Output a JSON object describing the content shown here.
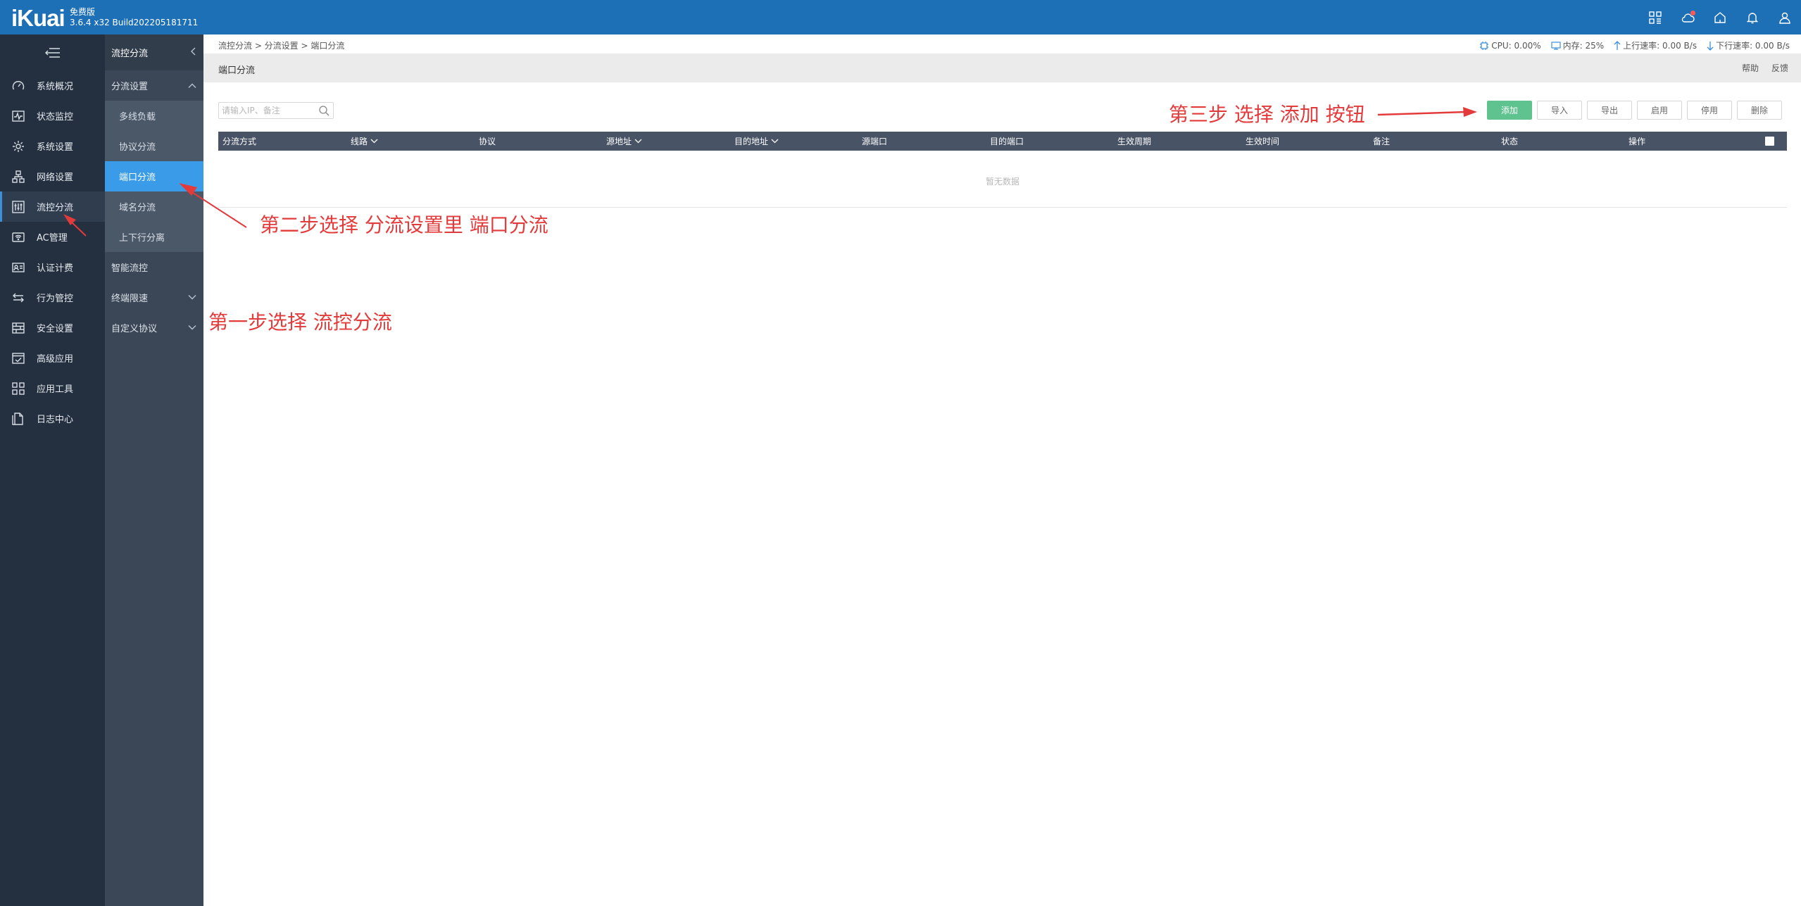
{
  "app": {
    "logo": "iKuai",
    "edition": "免费版",
    "build": "3.6.4 x32 Build202205181711"
  },
  "topbar_icons": [
    "apps-grid-icon",
    "cloud-icon",
    "home-icon",
    "bell-icon",
    "user-icon"
  ],
  "sidebar": {
    "items": [
      {
        "label": "系统概况",
        "icon": "dashboard-icon"
      },
      {
        "label": "状态监控",
        "icon": "monitor-icon"
      },
      {
        "label": "系统设置",
        "icon": "gear-icon"
      },
      {
        "label": "网络设置",
        "icon": "network-icon"
      },
      {
        "label": "流控分流",
        "icon": "sliders-icon",
        "active": true
      },
      {
        "label": "AC管理",
        "icon": "wifi-icon"
      },
      {
        "label": "认证计费",
        "icon": "id-card-icon"
      },
      {
        "label": "行为管控",
        "icon": "swap-icon"
      },
      {
        "label": "安全设置",
        "icon": "firewall-icon"
      },
      {
        "label": "高级应用",
        "icon": "check-window-icon"
      },
      {
        "label": "应用工具",
        "icon": "tools-grid-icon"
      },
      {
        "label": "日志中心",
        "icon": "document-icon"
      }
    ]
  },
  "subnav": {
    "title": "流控分流",
    "group_open": "分流设置",
    "sub_items": [
      "多线负载",
      "协议分流",
      "端口分流",
      "域名分流",
      "上下行分离"
    ],
    "active_sub": "端口分流",
    "groups_after": [
      {
        "label": "智能流控",
        "has_chevron": false
      },
      {
        "label": "终端限速",
        "has_chevron": true
      },
      {
        "label": "自定义协议",
        "has_chevron": true
      }
    ]
  },
  "breadcrumb": "流控分流 > 分流设置 > 端口分流",
  "stats": {
    "cpu": "CPU: 0.00%",
    "memory": "内存: 25%",
    "upload": "上行速率: 0.00 B/s",
    "download": "下行速率: 0.00 B/s"
  },
  "page": {
    "title": "端口分流",
    "help": "帮助",
    "feedback": "反馈"
  },
  "search": {
    "placeholder": "请输入IP、备注",
    "value": ""
  },
  "toolbar": {
    "add": "添加",
    "import": "导入",
    "export": "导出",
    "enable": "启用",
    "disable": "停用",
    "delete": "删除"
  },
  "table": {
    "columns": [
      {
        "label": "分流方式",
        "sortable": false
      },
      {
        "label": "线路",
        "sortable": true
      },
      {
        "label": "协议",
        "sortable": false
      },
      {
        "label": "源地址",
        "sortable": true
      },
      {
        "label": "目的地址",
        "sortable": true
      },
      {
        "label": "源端口",
        "sortable": false
      },
      {
        "label": "目的端口",
        "sortable": false
      },
      {
        "label": "生效周期",
        "sortable": false
      },
      {
        "label": "生效时间",
        "sortable": false
      },
      {
        "label": "备注",
        "sortable": false
      },
      {
        "label": "状态",
        "sortable": false
      },
      {
        "label": "操作",
        "sortable": false
      }
    ],
    "rows": [],
    "empty_text": "暂无数据"
  },
  "annotations": {
    "step1": "第一步选择 流控分流",
    "step2": "第二步选择 分流设置里 端口分流",
    "step3": "第三步 选择 添加 按钮"
  },
  "colors": {
    "topbar": "#1d6fb6",
    "sidebar": "#24303f",
    "subnav": "#3b4756",
    "active_sub": "#3a9ce8",
    "add_button": "#5fc38f",
    "table_header": "#485366",
    "annotation": "#e33b3b"
  }
}
